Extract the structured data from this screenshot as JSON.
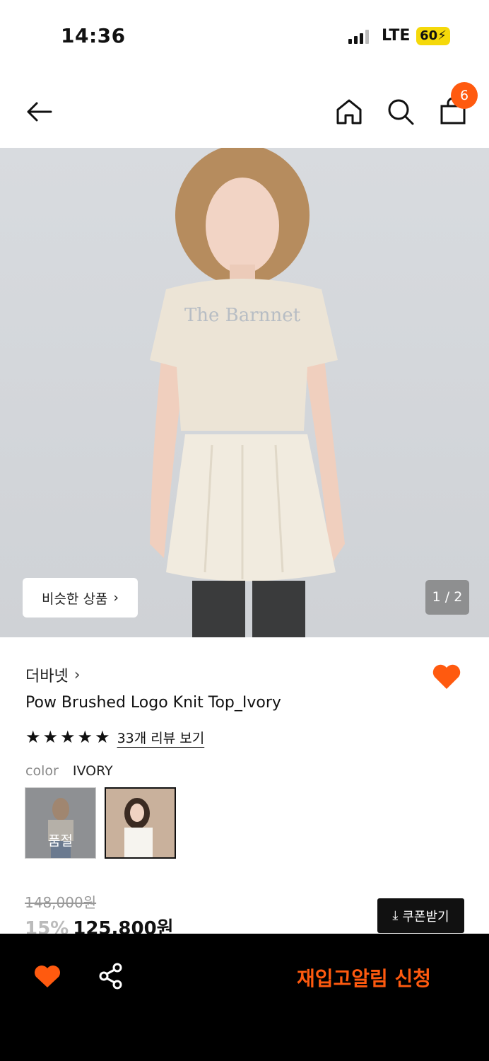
{
  "status_bar": {
    "time": "14:36",
    "network": "LTE",
    "battery": "60"
  },
  "nav": {
    "cart_count": "6"
  },
  "hero": {
    "similar_label": "비슷한 상품",
    "pager": "1 / 2",
    "background": "#d5d8dc"
  },
  "product": {
    "brand": "더바넷",
    "name": "Pow Brushed Logo Knit Top_Ivory",
    "rating_stars": 5,
    "review_link": "33개 리뷰 보기",
    "color_label": "color",
    "color_value": "IVORY",
    "swatch_soldout": "품절",
    "original_price": "148,000원",
    "discount": "15%",
    "sale_price": "125,800원",
    "coupon_label": "쿠폰받기"
  },
  "bottom_bar": {
    "restock_label": "재입고알림 신청"
  },
  "colors": {
    "accent": "#ff5a0f",
    "dark": "#111111"
  }
}
